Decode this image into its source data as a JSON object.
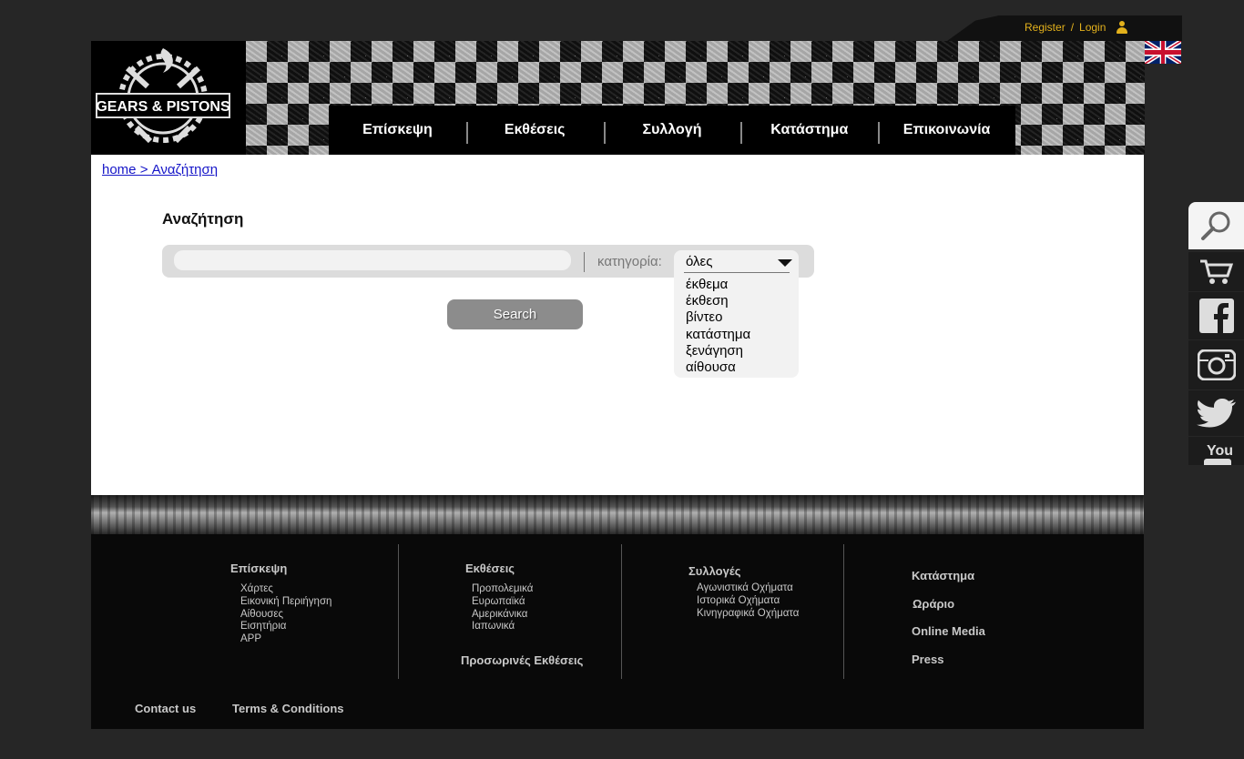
{
  "topbar": {
    "register": "Register",
    "separator": "/",
    "login": "Login"
  },
  "brand": {
    "logo_text": "GEARS & PISTONS"
  },
  "nav": [
    {
      "label": "Επίσκεψη"
    },
    {
      "label": "Εκθέσεις"
    },
    {
      "label": "Συλλογή"
    },
    {
      "label": "Κατάστημα"
    },
    {
      "label": "Επικοινωνία"
    }
  ],
  "breadcrumb": "home > Αναζήτηση",
  "search": {
    "title": "Αναζήτηση",
    "input_value": "",
    "category_label": "κατηγορία:",
    "selected": "όλες",
    "options": [
      "έκθεμα",
      "έκθεση",
      "βίντεο",
      "κατάστημα",
      "ξενάγηση",
      "αίθουσα"
    ],
    "button": "Search"
  },
  "footer": {
    "visit": {
      "heading": "Επίσκεψη",
      "items": [
        "Χάρτες",
        "Εικονική Περιήγηση",
        "Αίθουσες",
        "Εισητήρια",
        "APP"
      ]
    },
    "exhibitions": {
      "heading": "Εκθέσεις",
      "items": [
        "Προπολεμικά",
        "Ευρωπαϊκά",
        "Αμερικάνικα",
        "Ιαπωνικά"
      ],
      "temporary": "Προσωρινές Εκθέσεις"
    },
    "collections": {
      "heading": "Συλλογές",
      "items": [
        "Αγωνιστικά Οχήματα",
        "Ιστορικά Οχήματα",
        "Κινηγραφικά Οχήματα"
      ]
    },
    "store": {
      "items": [
        "Κατάστημα",
        "Ωράριο",
        "Online Media",
        "Press"
      ]
    },
    "bottom": {
      "contact": "Contact us",
      "terms": "Terms & Conditions"
    }
  },
  "colors": {
    "accent": "#e3b11c",
    "link": "#1515c8",
    "background": "#262626"
  }
}
